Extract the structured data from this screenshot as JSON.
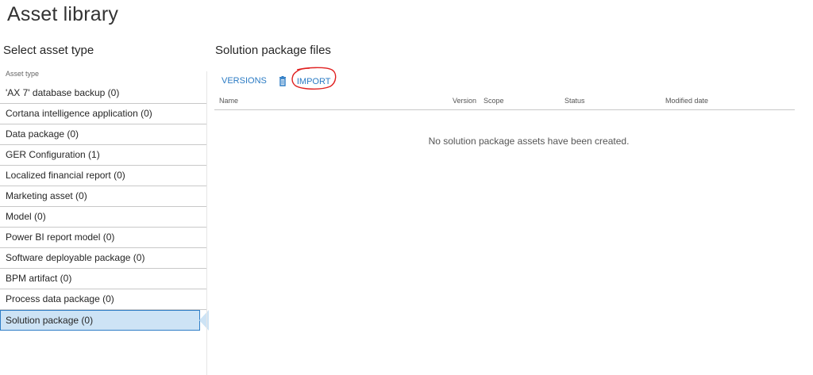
{
  "page": {
    "title": "Asset library"
  },
  "left": {
    "heading": "Select asset type",
    "column_header": "Asset type",
    "items": [
      {
        "label": "'AX 7' database backup (0)"
      },
      {
        "label": "Cortana intelligence application (0)"
      },
      {
        "label": "Data package (0)"
      },
      {
        "label": "GER Configuration (1)"
      },
      {
        "label": "Localized financial report (0)"
      },
      {
        "label": "Marketing asset (0)"
      },
      {
        "label": "Model (0)"
      },
      {
        "label": "Power BI report model (0)"
      },
      {
        "label": "Software deployable package (0)"
      },
      {
        "label": "BPM artifact (0)"
      },
      {
        "label": "Process data package (0)"
      },
      {
        "label": "Solution package (0)"
      }
    ],
    "selected_index": 11
  },
  "right": {
    "heading": "Solution package files",
    "toolbar": {
      "versions_label": "VERSIONS",
      "delete_icon": "trash-icon",
      "import_label": "IMPORT"
    },
    "columns": {
      "name": "Name",
      "version": "Version",
      "scope": "Scope",
      "status": "Status",
      "modified": "Modified date"
    },
    "empty_message": "No solution package assets have been created."
  },
  "colors": {
    "accent": "#2b7bc4",
    "selected_bg": "#cde3f5",
    "selected_border": "#2f7ec7",
    "annotation_circle": "#e02020"
  }
}
